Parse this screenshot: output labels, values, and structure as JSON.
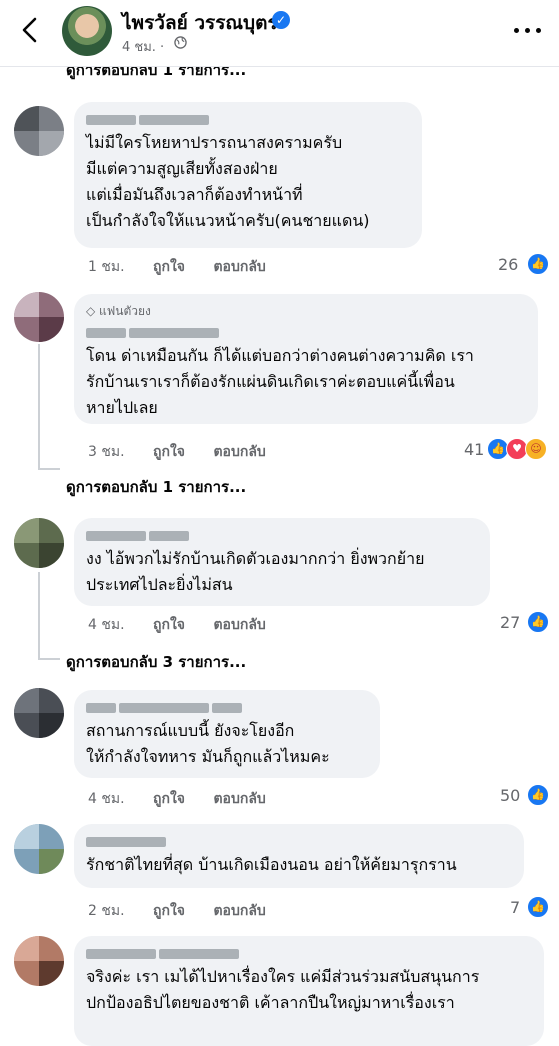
{
  "header": {
    "name": "ไพรวัลย์ วรรณบุตร",
    "time": "4 ชม. ·",
    "verified_glyph": "✓"
  },
  "top_replies_label": "ดูการตอบกลับ 1 รายการ...",
  "actions": {
    "like": "ถูกใจ",
    "reply": "ตอบกลับ"
  },
  "comments": [
    {
      "badge": "",
      "lines": [
        "ไม่มีใครโหยหาปรารถนาสงครามครับ",
        "มีแต่ความสูญเสียทั้งสองฝ่าย",
        "แต่เมื่อมันถึงเวลาก็ต้องทำหน้าที่",
        "เป็นกำลังใจให้แนวหน้าครับ(คนชายแดน)"
      ],
      "time": "1 ชม.",
      "reactions": "26"
    },
    {
      "badge": "แฟนตัวยง",
      "lines": [
        "โดน ด่าเหมือนกัน ก็ได้แต่บอกว่าต่างคนต่างความคิด เรา",
        "รักบ้านเราเราก็ต้องรักแผ่นดินเกิดเราค่ะตอบแค่นี้เพื่อน",
        "หายไปเลย"
      ],
      "time": "3 ชม.",
      "reactions": "41",
      "replies_label": "ดูการตอบกลับ 1 รายการ..."
    },
    {
      "badge": "",
      "lines": [
        "งง ไอ้พวกไม่รักบ้านเกิดตัวเองมากกว่า ยิ่งพวกย้าย",
        "ประเทศไปละยิ่งไม่สน"
      ],
      "time": "4 ชม.",
      "reactions": "27",
      "replies_label": "ดูการตอบกลับ 3 รายการ..."
    },
    {
      "badge": "",
      "lines": [
        "สถานการณ์แบบนี้ ยังจะโยงอีก",
        "ให้กำลังใจทหาร มันก็ถูกแล้วไหมคะ"
      ],
      "time": "4 ชม.",
      "reactions": "50"
    },
    {
      "badge": "",
      "lines": [
        "รักชาติไทยที่สุด บ้านเกิดเมืองนอน อย่าให้ค้ยมารุกราน"
      ],
      "time": "2 ชม.",
      "reactions": "7"
    },
    {
      "badge": "",
      "lines": [
        "จริงค่ะ เรา เมได้ไปหาเรื่องใคร แค่มีส่วนร่วมสนับสนุนการ",
        "ปกป้องอธิปไตยของชาติ เค้าลากปืนใหญ่มาหาเรื่องเรา"
      ]
    }
  ],
  "colors": {
    "accent": "#1877f2",
    "bubble": "#f0f2f5",
    "muted": "#65676b"
  }
}
